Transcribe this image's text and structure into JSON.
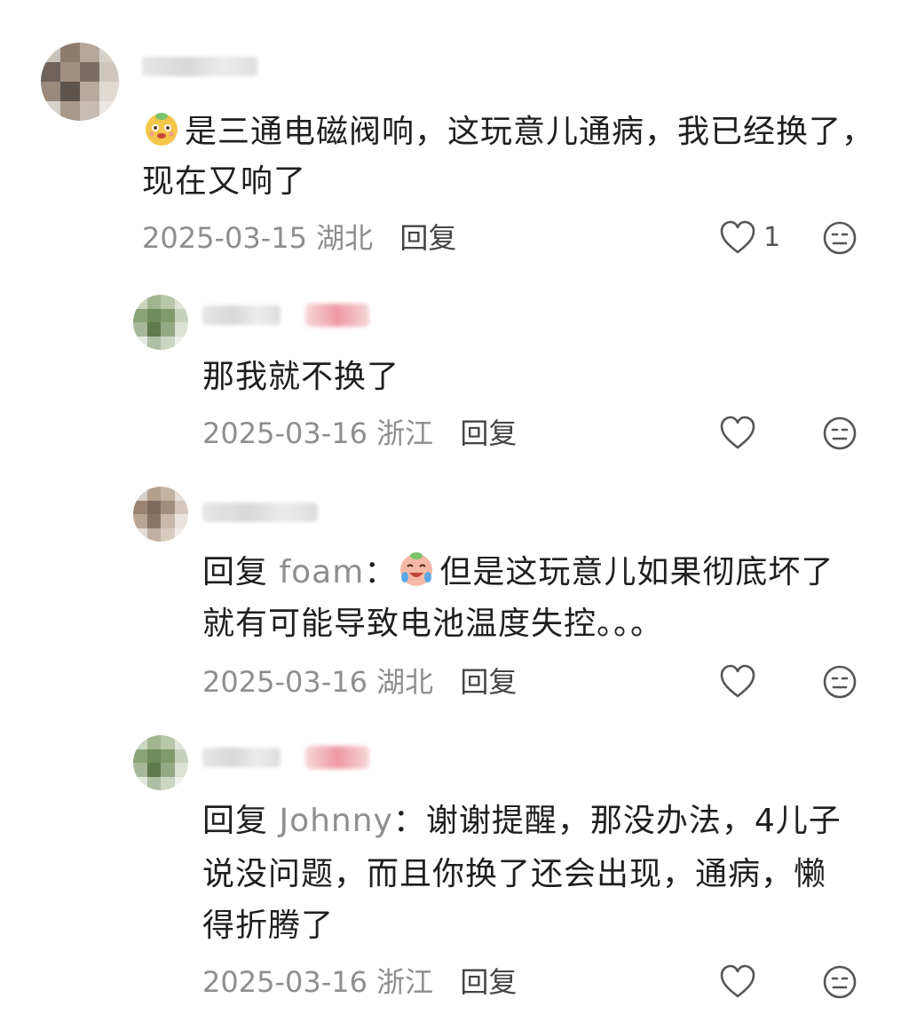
{
  "comments": [
    {
      "text_lines": [
        "是三通电磁阀响，这玩意儿通病，我已经换了，",
        "现在又响了"
      ],
      "date": "2025-03-15",
      "location": "湖北",
      "reply_label": "回复",
      "likes": "1",
      "emoji_icon": "puppy-face-emoji"
    },
    {
      "text_lines": [
        "那我就不换了"
      ],
      "date": "2025-03-16",
      "location": "浙江",
      "reply_label": "回复"
    },
    {
      "reply_prefix": "回复",
      "mention": "foam",
      "colon": "：",
      "text_lines": [
        "但是这玩意儿如果彻底坏了",
        "就有可能导致电池温度失控。。。"
      ],
      "date": "2025-03-16",
      "location": "湖北",
      "reply_label": "回复",
      "emoji_icon": "crying-laugh-emoji"
    },
    {
      "reply_prefix": "回复",
      "mention": "Johnny",
      "colon": "：",
      "text_lines": [
        "谢谢提醒，那没办法，4儿子",
        "说没问题，而且你换了还会出现，通病，懒",
        "得折腾了"
      ],
      "date": "2025-03-16",
      "location": "浙江",
      "reply_label": "回复"
    }
  ],
  "colors": {
    "text": "#1f1f1f",
    "meta": "#8e8e8e",
    "icon": "#555555"
  }
}
